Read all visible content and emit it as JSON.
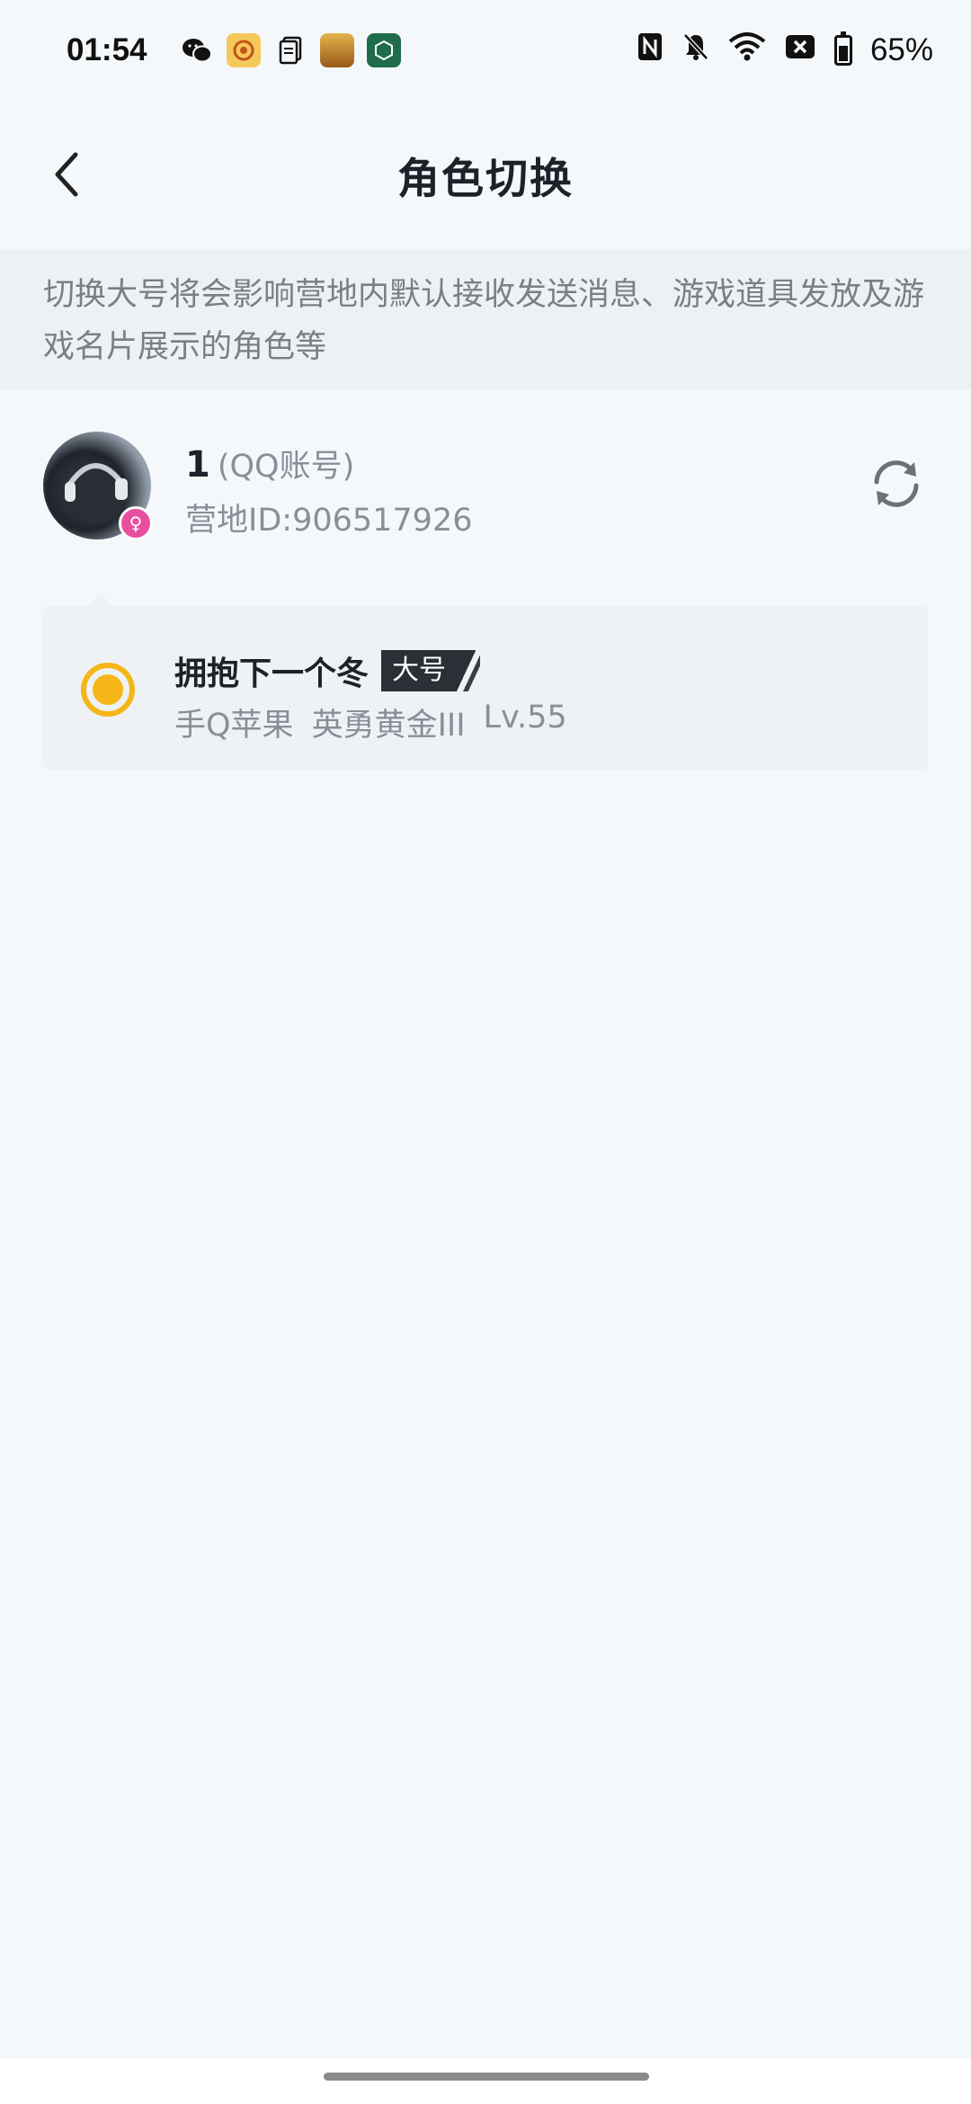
{
  "status_bar": {
    "time": "01:54",
    "battery": "65%",
    "notification_icons": [
      "wechat-icon",
      "game-app-icon",
      "document-icon",
      "game-app-icon-2",
      "game-assistant-icon"
    ],
    "system_icons": [
      "nfc-icon",
      "mute-icon",
      "wifi-icon",
      "sim-off-icon",
      "battery-icon"
    ]
  },
  "nav": {
    "title": "角色切换"
  },
  "notice": {
    "text": "切换大号将会影响营地内默认接收发送消息、游戏道具发放及游戏名片展示的角色等"
  },
  "account": {
    "name": "1",
    "type": "(QQ账号)",
    "camp_id": "营地ID:906517926",
    "badge": "♀"
  },
  "role": {
    "name": "拥抱下一个冬",
    "tag": "大号",
    "server": "手Q苹果",
    "rank": "英勇黄金III",
    "level": "Lv.55",
    "selected": true
  },
  "colors": {
    "accent": "#f6b617",
    "background": "#f5f8fb",
    "badge_female": "#e94f9f"
  }
}
